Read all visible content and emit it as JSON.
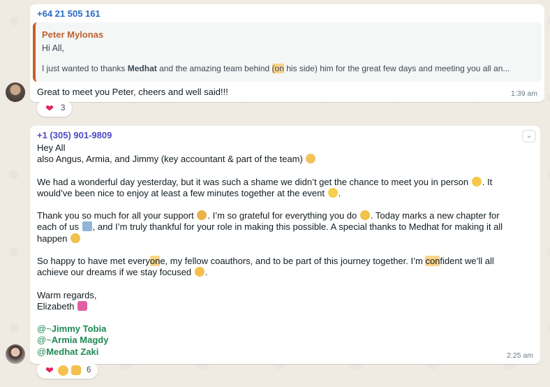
{
  "messages": [
    {
      "sender": "+64 21 505 161",
      "quote": {
        "author": "Peter Mylonas",
        "line1": "Hi All,",
        "line2_a": "I just wanted to thanks ",
        "line2_bold": "Medhat",
        "line2_b": " and the amazing team behind ",
        "line2_hl": "(on",
        "line2_c": " his side) him for the great few days and meeting you all an..."
      },
      "text": "Great to meet you Peter, cheers and well said!!!",
      "time": "1:39 am",
      "reactions": {
        "emoji": [
          "heart"
        ],
        "count": "3"
      }
    },
    {
      "sender": "+1 (305) 901-9809",
      "lines": {
        "l1": "Hey All",
        "l2": "also Angus, Armia, and Jimmy (key accountant & part of the team)",
        "l3": "We had a wonderful day yesterday, but it was such a shame we didn’t get the chance to meet you in person",
        "l3b": ". It",
        "l4": "would’ve been nice to enjoy at least a few minutes together at the event",
        "l4b": ".",
        "l5": "Thank you so much for all your support",
        "l5b": ". I’m so grateful for everything you do",
        "l5c": ". Today marks a new chapter for",
        "l6": "each of us",
        "l6b": ", and I’m truly thankful for your role in making this possible. A special thanks to Medhat for making it all",
        "l7": "happen",
        "l8a": "So happy to have met every",
        "l8hl": "on",
        "l8b": "e, my fellow coauthors, and to be part of this journey together. I’m ",
        "l8hl2": "con",
        "l8c": "fident we’ll all",
        "l9": "achieve our dreams if we stay focused",
        "l9b": ".",
        "l10": "Warm regards,",
        "l11": "Elizabeth"
      },
      "mentions": [
        {
          "prefix": "@~",
          "name": "Jimmy Tobia"
        },
        {
          "prefix": "@~",
          "name": "Armia Magdy"
        },
        {
          "prefix": "@",
          "name": "Medhat Zaki"
        }
      ],
      "time": "2:25 am",
      "reactions": {
        "emoji": [
          "heart",
          "smiling-face-with-hearts",
          "thumbs-up"
        ],
        "count": "6"
      }
    }
  ],
  "icons": {
    "chevron": "chevron-down-icon"
  }
}
